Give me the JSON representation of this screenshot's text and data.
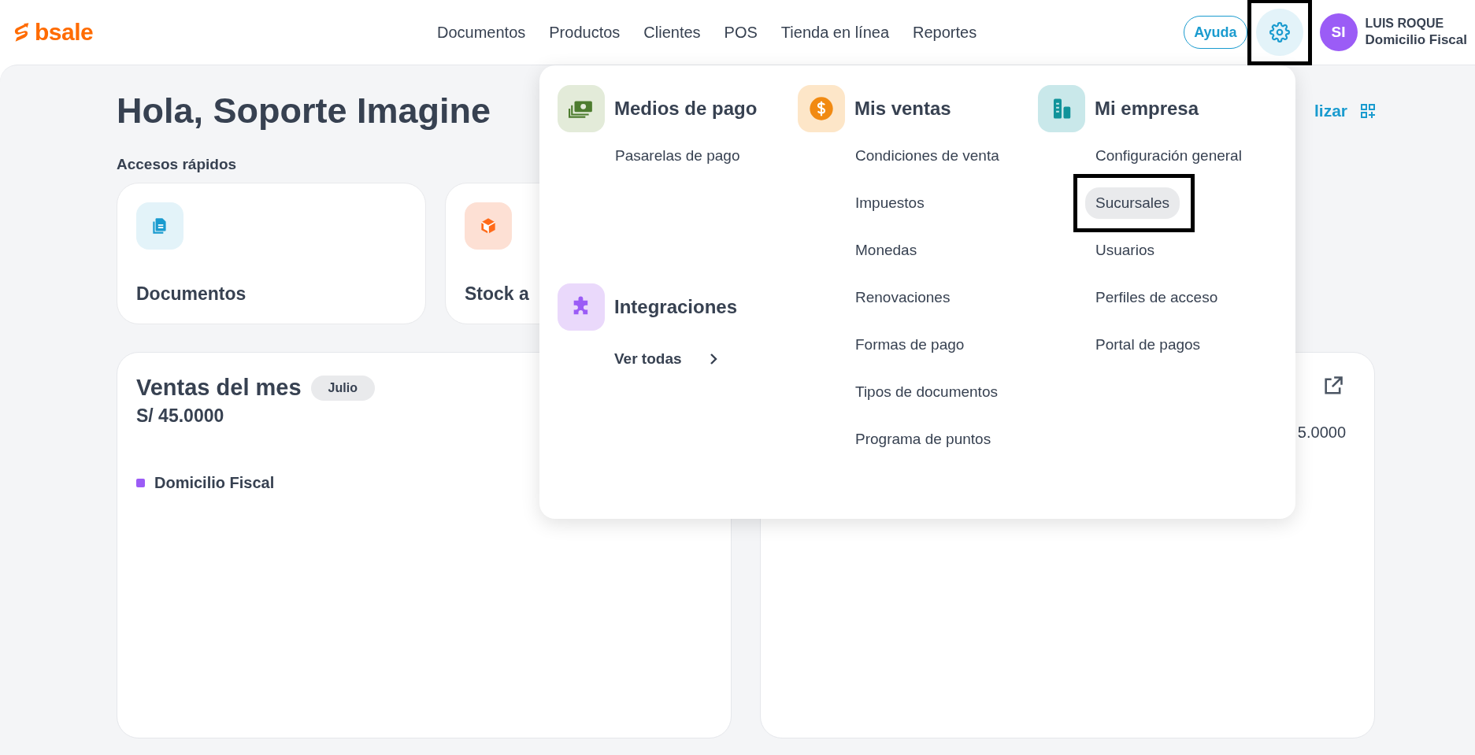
{
  "header": {
    "logo": "bsale",
    "nav": [
      {
        "label": "Documentos"
      },
      {
        "label": "Productos"
      },
      {
        "label": "Clientes"
      },
      {
        "label": "POS"
      },
      {
        "label": "Tienda en línea"
      },
      {
        "label": "Reportes"
      }
    ],
    "help_button": "Ayuda",
    "settings_button": {
      "highlighted": true
    },
    "avatar": "SI",
    "user_name": "LUIS ROQUE",
    "branch": "Domicilio Fiscal"
  },
  "page": {
    "greeting": "Hola, Soporte Imagine",
    "customize_button": "lizar",
    "quick_access_title": "Accesos rápidos",
    "quick_access": [
      {
        "label": "Documentos",
        "kind": "documents"
      },
      {
        "label": "Stock a",
        "kind": "stock"
      }
    ],
    "sales_card": {
      "title": "Ventas del mes",
      "month": "Julio",
      "total": "S/ 45.0000",
      "legend": [
        {
          "label": "Domicilio Fiscal",
          "color": "#9b5cf6"
        }
      ]
    },
    "second_card": {
      "value": "5.0000"
    }
  },
  "settings_menu": {
    "columns": [
      {
        "groups": [
          {
            "title": "Medios de pago",
            "kind": "money",
            "items": [
              {
                "label": "Pasarelas de pago",
                "selected": false,
                "highlighted": false
              }
            ]
          },
          {
            "title": "Integraciones",
            "kind": "puzzle",
            "link": "Ver todas"
          }
        ]
      },
      {
        "groups": [
          {
            "title": "Mis ventas",
            "kind": "coin",
            "items": [
              {
                "label": "Condiciones de venta",
                "selected": false,
                "highlighted": false
              },
              {
                "label": "Impuestos",
                "selected": false,
                "highlighted": false
              },
              {
                "label": "Monedas",
                "selected": false,
                "highlighted": false
              },
              {
                "label": "Renovaciones",
                "selected": false,
                "highlighted": false
              },
              {
                "label": "Formas de pago",
                "selected": false,
                "highlighted": false
              },
              {
                "label": "Tipos de documentos",
                "selected": false,
                "highlighted": false
              },
              {
                "label": "Programa de puntos",
                "selected": false,
                "highlighted": false
              }
            ]
          }
        ]
      },
      {
        "groups": [
          {
            "title": "Mi empresa",
            "kind": "building",
            "items": [
              {
                "label": "Configuración general",
                "selected": false,
                "highlighted": false
              },
              {
                "label": "Sucursales",
                "selected": true,
                "highlighted": true
              },
              {
                "label": "Usuarios",
                "selected": false,
                "highlighted": false
              },
              {
                "label": "Perfiles de acceso",
                "selected": false,
                "highlighted": false
              },
              {
                "label": "Portal de pagos",
                "selected": false,
                "highlighted": false
              }
            ]
          }
        ]
      }
    ]
  }
}
